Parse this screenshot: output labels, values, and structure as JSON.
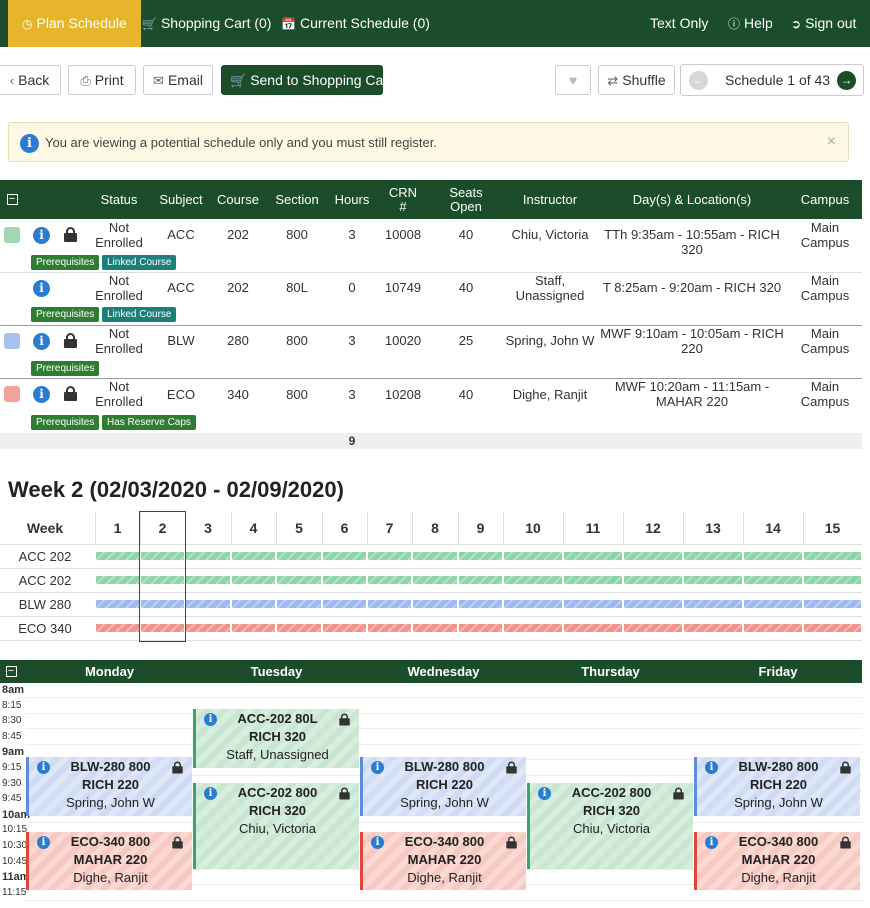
{
  "nav": {
    "plan_schedule": "Plan Schedule",
    "shopping_cart": "Shopping Cart (0)",
    "current_schedule": "Current Schedule (0)",
    "text_only": "Text Only",
    "help": "Help",
    "sign_out": "Sign out"
  },
  "toolbar": {
    "back": "Back",
    "print": "Print",
    "email": "Email",
    "send_to_cart": "Send to Shopping Cart",
    "shuffle": "Shuffle",
    "schedule_label": "Schedule 1 of 43"
  },
  "alert": {
    "message": "You are viewing a potential schedule only and you must still register."
  },
  "table": {
    "headers": {
      "status": "Status",
      "subject": "Subject",
      "course": "Course",
      "section": "Section",
      "hours": "Hours",
      "crn_1": "CRN",
      "crn_2": "#",
      "seats_1": "Seats",
      "seats_2": "Open",
      "instructor": "Instructor",
      "days_loc": "Day(s) & Location(s)",
      "campus": "Campus"
    },
    "rows": [
      {
        "color": "#9fd8b3",
        "status_1": "Not",
        "status_2": "Enrolled",
        "subject": "ACC",
        "course": "202",
        "section": "800",
        "hours": "3",
        "crn": "10008",
        "seats": "40",
        "instructor_1": "Chiu, Victoria",
        "instructor_2": "",
        "days_1": "TTh 9:35am - 10:55am - RICH 320",
        "days_2": "",
        "campus_1": "Main",
        "campus_2": "Campus",
        "tag1": "Prerequisites",
        "tag2": "Linked Course"
      },
      {
        "color": "",
        "status_1": "Not",
        "status_2": "Enrolled",
        "subject": "ACC",
        "course": "202",
        "section": "80L",
        "hours": "0",
        "crn": "10749",
        "seats": "40",
        "instructor_1": "Staff,",
        "instructor_2": "Unassigned",
        "days_1": "T 8:25am - 9:20am - RICH 320",
        "days_2": "",
        "campus_1": "Main",
        "campus_2": "Campus",
        "tag1": "Prerequisites",
        "tag2": "Linked Course"
      },
      {
        "color": "#a9c1f0",
        "status_1": "Not",
        "status_2": "Enrolled",
        "subject": "BLW",
        "course": "280",
        "section": "800",
        "hours": "3",
        "crn": "10020",
        "seats": "25",
        "instructor_1": "Spring, John W",
        "instructor_2": "",
        "days_1": "MWF 9:10am - 10:05am - RICH",
        "days_2": "220",
        "campus_1": "Main",
        "campus_2": "Campus",
        "tag1": "Prerequisites",
        "tag2": ""
      },
      {
        "color": "#f3a49a",
        "status_1": "Not",
        "status_2": "Enrolled",
        "subject": "ECO",
        "course": "340",
        "section": "800",
        "hours": "3",
        "crn": "10208",
        "seats": "40",
        "instructor_1": "Dighe, Ranjit",
        "instructor_2": "",
        "days_1": "MWF 10:20am - 11:15am -",
        "days_2": "MAHAR 220",
        "campus_1": "Main",
        "campus_2": "Campus",
        "tag1": "Prerequisites",
        "tag2": "Has Reserve Caps"
      }
    ],
    "total_hours": "9"
  },
  "week": {
    "title": "Week 2 (02/03/2020 - 02/09/2020)",
    "header_label": "Week",
    "numbers": [
      "1",
      "2",
      "3",
      "4",
      "5",
      "6",
      "7",
      "8",
      "9",
      "10",
      "11",
      "12",
      "13",
      "14",
      "15"
    ],
    "courses": [
      {
        "label": "ACC 202",
        "color": "#8fd3a8"
      },
      {
        "label": "ACC 202",
        "color": "#8fd3a8"
      },
      {
        "label": "BLW 280",
        "color": "#9db9ee"
      },
      {
        "label": "ECO 340",
        "color": "#f0938a"
      }
    ]
  },
  "calendar": {
    "days": [
      "Monday",
      "Tuesday",
      "Wednesday",
      "Thursday",
      "Friday"
    ],
    "times": [
      "8am",
      "8:15",
      "8:30",
      "8:45",
      "9am",
      "9:15",
      "9:30",
      "9:45",
      "10am",
      "10:15",
      "10:30",
      "10:45",
      "11am",
      "11:15"
    ],
    "events": {
      "blw": {
        "t1": "BLW-280 800",
        "t2": "RICH 220",
        "t3": "Spring, John W"
      },
      "acc_lab": {
        "t1": "ACC-202 80L",
        "t2": "RICH 320",
        "t3": "Staff, Unassigned"
      },
      "acc": {
        "t1": "ACC-202 800",
        "t2": "RICH 320",
        "t3": "Chiu, Victoria"
      },
      "eco": {
        "t1": "ECO-340 800",
        "t2": "MAHAR 220",
        "t3": "Dighe, Ranjit"
      }
    }
  }
}
